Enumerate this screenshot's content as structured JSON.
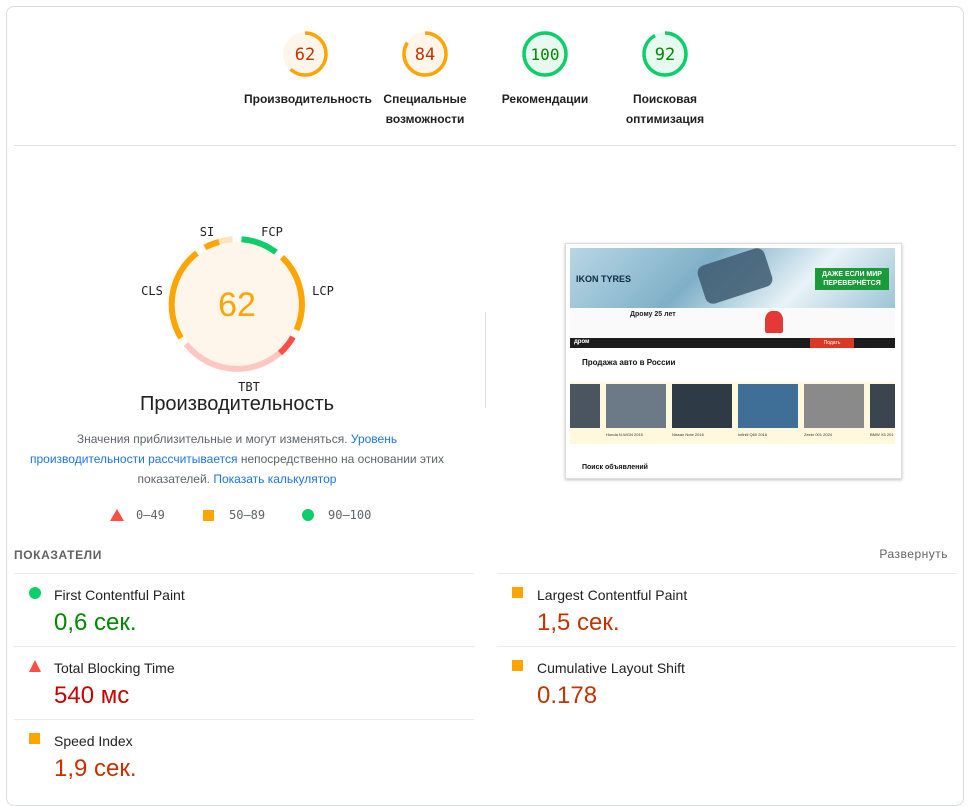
{
  "gauges": [
    {
      "score": "62",
      "label": "Производительность",
      "status": "average"
    },
    {
      "score": "84",
      "label": "Специальные возможности",
      "status": "average"
    },
    {
      "score": "100",
      "label": "Рекомендации",
      "status": "pass"
    },
    {
      "score": "92",
      "label": "Поисковая оптимизация",
      "status": "pass"
    }
  ],
  "colors": {
    "pass": "#0cce6b",
    "average": "#ffa400",
    "fail": "#ff4e42",
    "pass_text": "#008800",
    "average_text": "#c33300",
    "fail_text": "#c80000"
  },
  "perf": {
    "score": "62",
    "title": "Производительность",
    "segment_labels": {
      "si": "SI",
      "fcp": "FCP",
      "lcp": "LCP",
      "tbt": "TBT",
      "cls": "CLS"
    },
    "desc_1": "Значения приблизительные и могут изменяться.",
    "desc_link": "Уровень производительности рассчитывается",
    "desc_2": "непосредственно на основании этих показателей.",
    "calc_link": "Показать калькулятор"
  },
  "legend": {
    "fail": "0–49",
    "average": "50–89",
    "pass": "90–100"
  },
  "screenshot": {
    "banner_brand": "IKON TYRES",
    "banner_slogan": "ДАЖЕ ЕСЛИ МИР ПЕРЕВЕРНЁТСЯ",
    "promo_title": "Дрому 25 лет",
    "site_logo": "дром",
    "post_ad": "Подать объявление",
    "section_title": "Продажа авто в России",
    "cars": [
      "Honda N-WGN 2015",
      "Nissan Note 2016",
      "Infiniti Q60 2016",
      "Zeekr 001 2024",
      "BMW X5 201"
    ],
    "search_title": "Поиск объявлений"
  },
  "metrics": {
    "header": "ПОКАЗАТЕЛИ",
    "expand": "Развернуть",
    "fcp": {
      "name": "First Contentful Paint",
      "value": "0,6 сек.",
      "status": "pass"
    },
    "lcp": {
      "name": "Largest Contentful Paint",
      "value": "1,5 сек.",
      "status": "average"
    },
    "tbt": {
      "name": "Total Blocking Time",
      "value": "540 мс",
      "status": "fail"
    },
    "cls": {
      "name": "Cumulative Layout Shift",
      "value": "0.178",
      "status": "average"
    },
    "si": {
      "name": "Speed Index",
      "value": "1,9 сек.",
      "status": "average"
    }
  }
}
